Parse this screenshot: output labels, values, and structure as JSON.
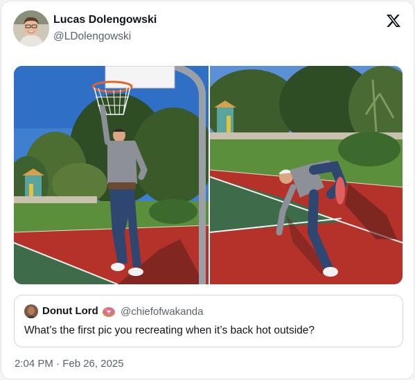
{
  "post": {
    "author": {
      "name": "Lucas Dolengowski",
      "handle": "@LDolengowski"
    },
    "platform_icon": "x-logo-icon",
    "media": [
      {
        "icon": "photo-basketball-dunk"
      },
      {
        "icon": "photo-basketball-kick"
      }
    ],
    "quoted_post": {
      "name": "Donut Lord",
      "emoji_icon": "donut-icon",
      "handle": "@chiefofwakanda",
      "text": "What’s the first pic you recreating when it’s back hot outside?"
    },
    "timestamp": "2:04 PM · Feb 26, 2025"
  },
  "colors": {
    "text_primary": "#0f1419",
    "text_secondary": "#536471",
    "border": "#cfd9de",
    "court_red": "#b4322a",
    "court_green": "#3e6b4a"
  }
}
